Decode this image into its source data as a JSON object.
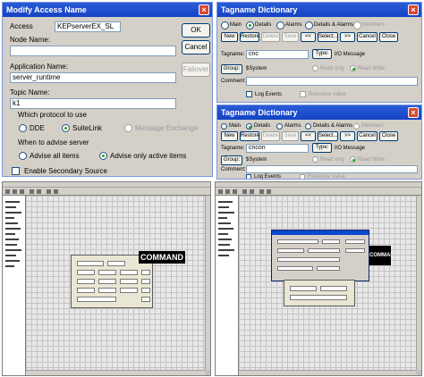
{
  "access_dialog": {
    "title": "Modify Access Name",
    "access_label": "Access",
    "access_value": "KEPserverEX_SL",
    "node_name_label": "Node Name:",
    "node_name_value": "",
    "application_name_label": "Application Name:",
    "application_name_value": "server_runtime",
    "topic_name_label": "Topic Name:",
    "topic_name_value": "k1",
    "ok_label": "OK",
    "cancel_label": "Cancel",
    "failover_label": "Failover",
    "protocol_group_label": "Which protocol to use",
    "protocol_options": [
      "DDE",
      "SuiteLink",
      "Message Exchange"
    ],
    "protocol_selected": "SuiteLink",
    "advise_group_label": "When to advise server",
    "advise_options": [
      "Advise all items",
      "Advise only active items"
    ],
    "advise_selected": "Advise only active items",
    "secondary_source_label": "Enable Secondary Source"
  },
  "tagname_dictionary_top": {
    "title": "Tagname Dictionary",
    "mode_options": [
      "Main",
      "Details",
      "Alarms",
      "Details & Alarms",
      "Members"
    ],
    "buttons": [
      "New",
      "Restore",
      "Delete",
      "Save",
      "<<",
      "Select...",
      ">>",
      "Cancel",
      "Close"
    ],
    "tagname_label": "Tagname:",
    "tagname_value": "cnc",
    "type_button": "Type:",
    "type_value": "I/O Message",
    "group_button": "Group:",
    "group_value": "$System",
    "read_only_label": "Read only",
    "read_write_label": "Read Write",
    "comment_label": "Comment:",
    "log_events_label": "Log Events",
    "retentive_value_label": "Retentive Value"
  },
  "tagname_dictionary_bottom": {
    "title": "Tagname Dictionary",
    "mode_options": [
      "Main",
      "Details",
      "Alarms",
      "Details & Alarms",
      "Members"
    ],
    "buttons": [
      "New",
      "Restore",
      "Delete",
      "Save",
      "<<",
      "Select...",
      ">>",
      "Cancel",
      "Close"
    ],
    "tagname_label": "Tagname:",
    "tagname_value": "cncon",
    "type_button": "Type:",
    "type_value": "I/O Message",
    "group_button": "Group:",
    "group_value": "$System",
    "read_only_label": "Read only",
    "read_write_label": "Read Write",
    "comment_label": "Comment:",
    "log_events_label": "Log Events",
    "retentive_value_label": "Retentive Value"
  },
  "screenshot_left": {
    "banner_text": "COMMAND"
  },
  "screenshot_right": {
    "banner_text": "COMMAND"
  }
}
